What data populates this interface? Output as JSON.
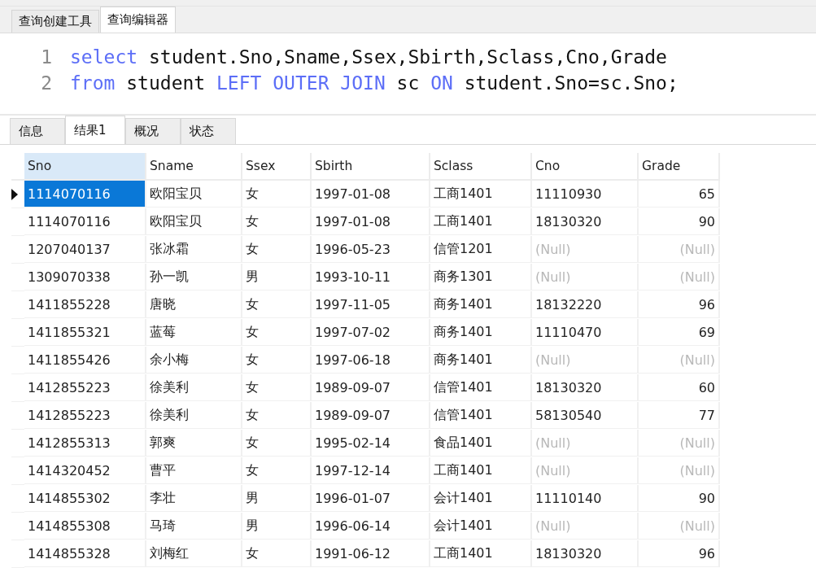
{
  "editor_tabs": [
    {
      "label": "查询创建工具",
      "selected": false
    },
    {
      "label": "查询编辑器",
      "selected": true
    }
  ],
  "code_lines": [
    {
      "number": "1",
      "tokens": [
        {
          "text": "select",
          "keyword": true
        },
        {
          "text": " student.Sno,Sname,Ssex,Sbirth,Sclass,Cno,Grade",
          "keyword": false
        }
      ]
    },
    {
      "number": "2",
      "tokens": [
        {
          "text": "from",
          "keyword": true
        },
        {
          "text": " student ",
          "keyword": false
        },
        {
          "text": "LEFT OUTER JOIN",
          "keyword": true
        },
        {
          "text": " sc ",
          "keyword": false
        },
        {
          "text": "ON",
          "keyword": true
        },
        {
          "text": " student.Sno=sc.Sno;",
          "keyword": false
        }
      ]
    }
  ],
  "result_tabs": [
    {
      "label": "信息",
      "selected": false
    },
    {
      "label": "结果1",
      "selected": true
    },
    {
      "label": "概况",
      "selected": false
    },
    {
      "label": "状态",
      "selected": false
    }
  ],
  "table": {
    "columns": [
      "Sno",
      "Sname",
      "Ssex",
      "Sbirth",
      "Sclass",
      "Cno",
      "Grade"
    ],
    "rows": [
      {
        "selected": true,
        "cells": [
          "1114070116",
          "欧阳宝贝",
          "女",
          "1997-01-08",
          "工商1401",
          "11110930",
          "65"
        ]
      },
      {
        "selected": false,
        "cells": [
          "1114070116",
          "欧阳宝贝",
          "女",
          "1997-01-08",
          "工商1401",
          "18130320",
          "90"
        ]
      },
      {
        "selected": false,
        "cells": [
          "1207040137",
          "张冰霜",
          "女",
          "1996-05-23",
          "信管1201",
          {
            "text": "(Null)",
            "null": true
          },
          {
            "text": "(Null)",
            "null": true
          }
        ]
      },
      {
        "selected": false,
        "cells": [
          "1309070338",
          "孙一凯",
          "男",
          "1993-10-11",
          "商务1301",
          {
            "text": "(Null)",
            "null": true
          },
          {
            "text": "(Null)",
            "null": true
          }
        ]
      },
      {
        "selected": false,
        "cells": [
          "1411855228",
          "唐晓",
          "女",
          "1997-11-05",
          "商务1401",
          "18132220",
          "96"
        ]
      },
      {
        "selected": false,
        "cells": [
          "1411855321",
          "蓝莓",
          "女",
          "1997-07-02",
          "商务1401",
          "11110470",
          "69"
        ]
      },
      {
        "selected": false,
        "cells": [
          "1411855426",
          "余小梅",
          "女",
          "1997-06-18",
          "商务1401",
          {
            "text": "(Null)",
            "null": true
          },
          {
            "text": "(Null)",
            "null": true
          }
        ]
      },
      {
        "selected": false,
        "cells": [
          "1412855223",
          "徐美利",
          "女",
          "1989-09-07",
          "信管1401",
          "18130320",
          "60"
        ]
      },
      {
        "selected": false,
        "cells": [
          "1412855223",
          "徐美利",
          "女",
          "1989-09-07",
          "信管1401",
          "58130540",
          "77"
        ]
      },
      {
        "selected": false,
        "cells": [
          "1412855313",
          "郭爽",
          "女",
          "1995-02-14",
          "食品1401",
          {
            "text": "(Null)",
            "null": true
          },
          {
            "text": "(Null)",
            "null": true
          }
        ]
      },
      {
        "selected": false,
        "cells": [
          "1414320452",
          "曹平",
          "女",
          "1997-12-14",
          "工商1401",
          {
            "text": "(Null)",
            "null": true
          },
          {
            "text": "(Null)",
            "null": true
          }
        ]
      },
      {
        "selected": false,
        "cells": [
          "1414855302",
          "李壮",
          "男",
          "1996-01-07",
          "会计1401",
          "11110140",
          "90"
        ]
      },
      {
        "selected": false,
        "cells": [
          "1414855308",
          "马琦",
          "男",
          "1996-06-14",
          "会计1401",
          {
            "text": "(Null)",
            "null": true
          },
          {
            "text": "(Null)",
            "null": true
          }
        ]
      },
      {
        "selected": false,
        "cells": [
          "1414855328",
          "刘梅红",
          "女",
          "1991-06-12",
          "工商1401",
          "18130320",
          "96"
        ]
      }
    ]
  }
}
